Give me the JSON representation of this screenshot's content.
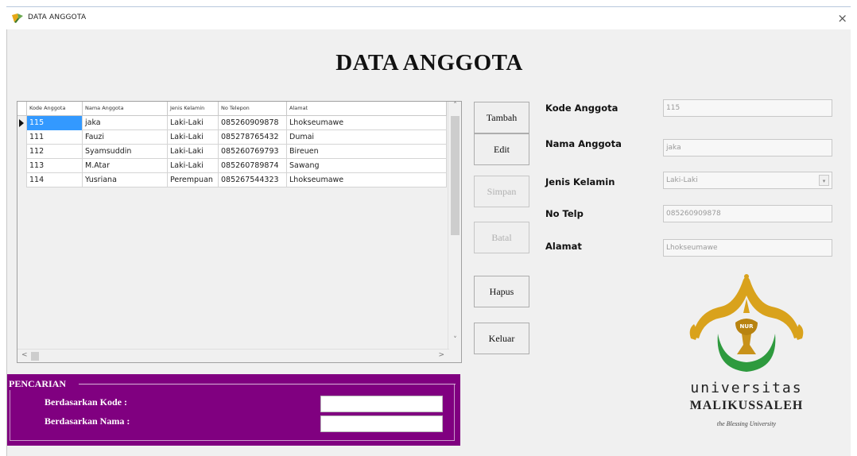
{
  "window": {
    "title": "DATA ANGGOTA",
    "close_glyph": "×"
  },
  "form": {
    "heading": "DATA ANGGOTA"
  },
  "grid": {
    "columns": [
      "Kode Anggota",
      "Nama Anggota",
      "Jenis Kelamin",
      "No Telepon",
      "Alamat"
    ],
    "rows": [
      [
        "115",
        "jaka",
        "Laki-Laki",
        "085260909878",
        "Lhokseumawe"
      ],
      [
        "111",
        "Fauzi",
        "Laki-Laki",
        "085278765432",
        "Dumai"
      ],
      [
        "112",
        "Syamsuddin",
        "Laki-Laki",
        "085260769793",
        "Bireuen"
      ],
      [
        "113",
        "M.Atar",
        "Laki-Laki",
        "085260789874",
        "Sawang"
      ],
      [
        "114",
        "Yusriana",
        "Perempuan",
        "085267544323",
        "Lhokseumawe"
      ]
    ],
    "selected_row": 0
  },
  "buttons": {
    "tambah": "Tambah",
    "edit": "Edit",
    "simpan": "Simpan",
    "batal": "Batal",
    "hapus": "Hapus",
    "keluar": "Keluar"
  },
  "fields": {
    "kode_label": "Kode Anggota",
    "kode_value": "115",
    "nama_label": "Nama Anggota",
    "nama_value": "jaka",
    "jk_label": "Jenis Kelamin",
    "jk_value": "Laki-Laki",
    "telp_label": "No Telp",
    "telp_value": "085260909878",
    "alamat_label": "Alamat",
    "alamat_value": "Lhokseumawe"
  },
  "search": {
    "legend": "PENCARIAN",
    "kode_label": "Berdasarkan Kode :",
    "nama_label": "Berdasarkan Nama :",
    "kode_value": "",
    "nama_value": ""
  },
  "logo": {
    "line1": "universitas",
    "line2": "MALIKUSSALEH",
    "line3": "the Blessing University",
    "emblem_text": "NUR"
  },
  "colors": {
    "search_panel": "#800080",
    "selection": "#3399ff",
    "logo_gold": "#d9a21c",
    "logo_green": "#2e9a3e"
  }
}
